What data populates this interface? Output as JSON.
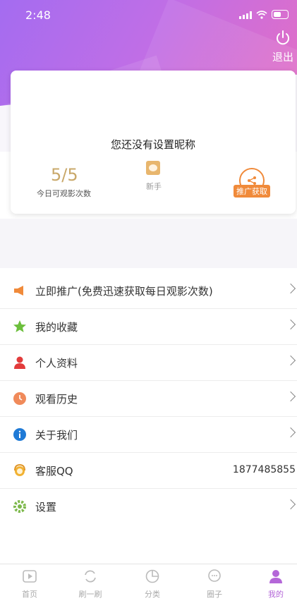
{
  "status_bar": {
    "time": "2:48"
  },
  "header": {
    "logout_label": "退出"
  },
  "profile": {
    "nickname": "您还没有设置昵称",
    "views_count": "5/5",
    "views_label": "今日可观影次数",
    "rank_label": "新手",
    "promo_label": "推广获取"
  },
  "menu": {
    "items": [
      {
        "label": "立即推广(免费迅速获取每日观影次数)",
        "icon": "megaphone-icon",
        "color": "#f08a3a"
      },
      {
        "label": "我的收藏",
        "icon": "star-icon",
        "color": "#6cbf3c"
      },
      {
        "label": "个人资料",
        "icon": "person-icon",
        "color": "#e23b3b"
      },
      {
        "label": "观看历史",
        "icon": "clock-icon",
        "color": "#f08a5a"
      },
      {
        "label": "关于我们",
        "icon": "info-icon",
        "color": "#1f7ad6"
      },
      {
        "label": "客服QQ",
        "icon": "support-icon",
        "color": "#f2b233",
        "value": "1877485855"
      },
      {
        "label": "设置",
        "icon": "gear-icon",
        "color": "#7cb84a"
      }
    ]
  },
  "tabs": [
    {
      "label": "首页",
      "icon": "play-icon"
    },
    {
      "label": "刷一刷",
      "icon": "refresh-icon"
    },
    {
      "label": "分类",
      "icon": "pie-icon"
    },
    {
      "label": "圈子",
      "icon": "chat-icon"
    },
    {
      "label": "我的",
      "icon": "user-icon",
      "active": true
    }
  ],
  "colors": {
    "accent": "#b467d8",
    "orange": "#f08a3a"
  }
}
